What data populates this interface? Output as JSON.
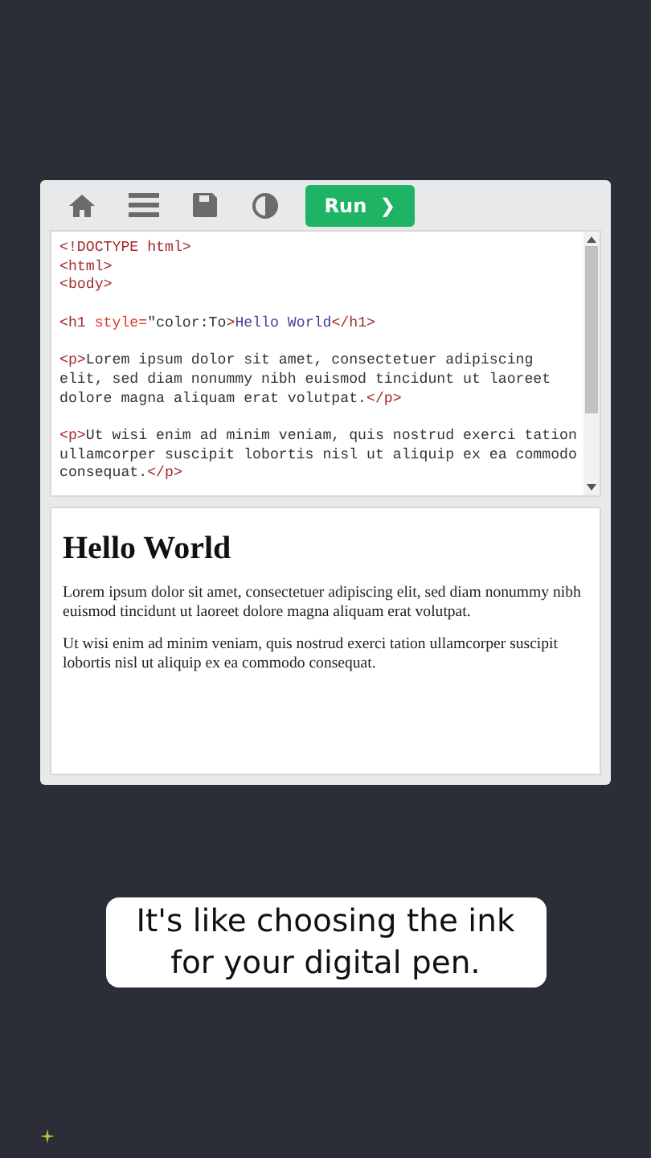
{
  "toolbar": {
    "run_button": {
      "label": "Run",
      "caret": "❯"
    }
  },
  "editor": {
    "blocks": [
      [
        [
          {
            "kind": "tag",
            "text": "<!DOCTYPE html>"
          }
        ],
        [
          {
            "kind": "tag",
            "text": "<html>"
          }
        ],
        [
          {
            "kind": "tag",
            "text": "<body>"
          }
        ]
      ],
      [
        [
          {
            "kind": "tag",
            "text": "<h1 "
          },
          {
            "kind": "attr",
            "text": "style="
          },
          {
            "kind": "value",
            "text": "\"color:To"
          },
          {
            "kind": "tag",
            "text": ">"
          },
          {
            "kind": "content",
            "text": "Hello World"
          },
          {
            "kind": "tag",
            "text": "</h1>"
          }
        ]
      ],
      [
        [
          {
            "kind": "tag",
            "text": "<p>"
          },
          {
            "kind": "text",
            "text": "Lorem ipsum dolor sit amet, consectetuer adipiscing"
          }
        ],
        [
          {
            "kind": "text",
            "text": "elit, sed diam nonummy nibh euismod tincidunt ut laoreet"
          }
        ],
        [
          {
            "kind": "text",
            "text": "dolore magna aliquam erat volutpat."
          },
          {
            "kind": "tag",
            "text": "</p>"
          }
        ]
      ],
      [
        [
          {
            "kind": "tag",
            "text": "<p>"
          },
          {
            "kind": "text",
            "text": "Ut wisi enim ad minim veniam, quis nostrud exerci tation"
          }
        ],
        [
          {
            "kind": "text",
            "text": "ullamcorper suscipit lobortis nisl ut aliquip ex ea commodo"
          }
        ],
        [
          {
            "kind": "text",
            "text": "consequat."
          },
          {
            "kind": "tag",
            "text": "</p>"
          }
        ]
      ]
    ]
  },
  "output": {
    "heading": "Hello World",
    "paragraphs": [
      "Lorem ipsum dolor sit amet, consectetuer adipiscing elit, sed diam nonummy nibh euismod tincidunt ut laoreet dolore magna aliquam erat volutpat.",
      "Ut wisi enim ad minim veniam, quis nostrud exerci tation ullamcorper suscipit lobortis nisl ut aliquip ex ea commodo consequat."
    ]
  },
  "caption": "It's like choosing the ink for your digital pen."
}
